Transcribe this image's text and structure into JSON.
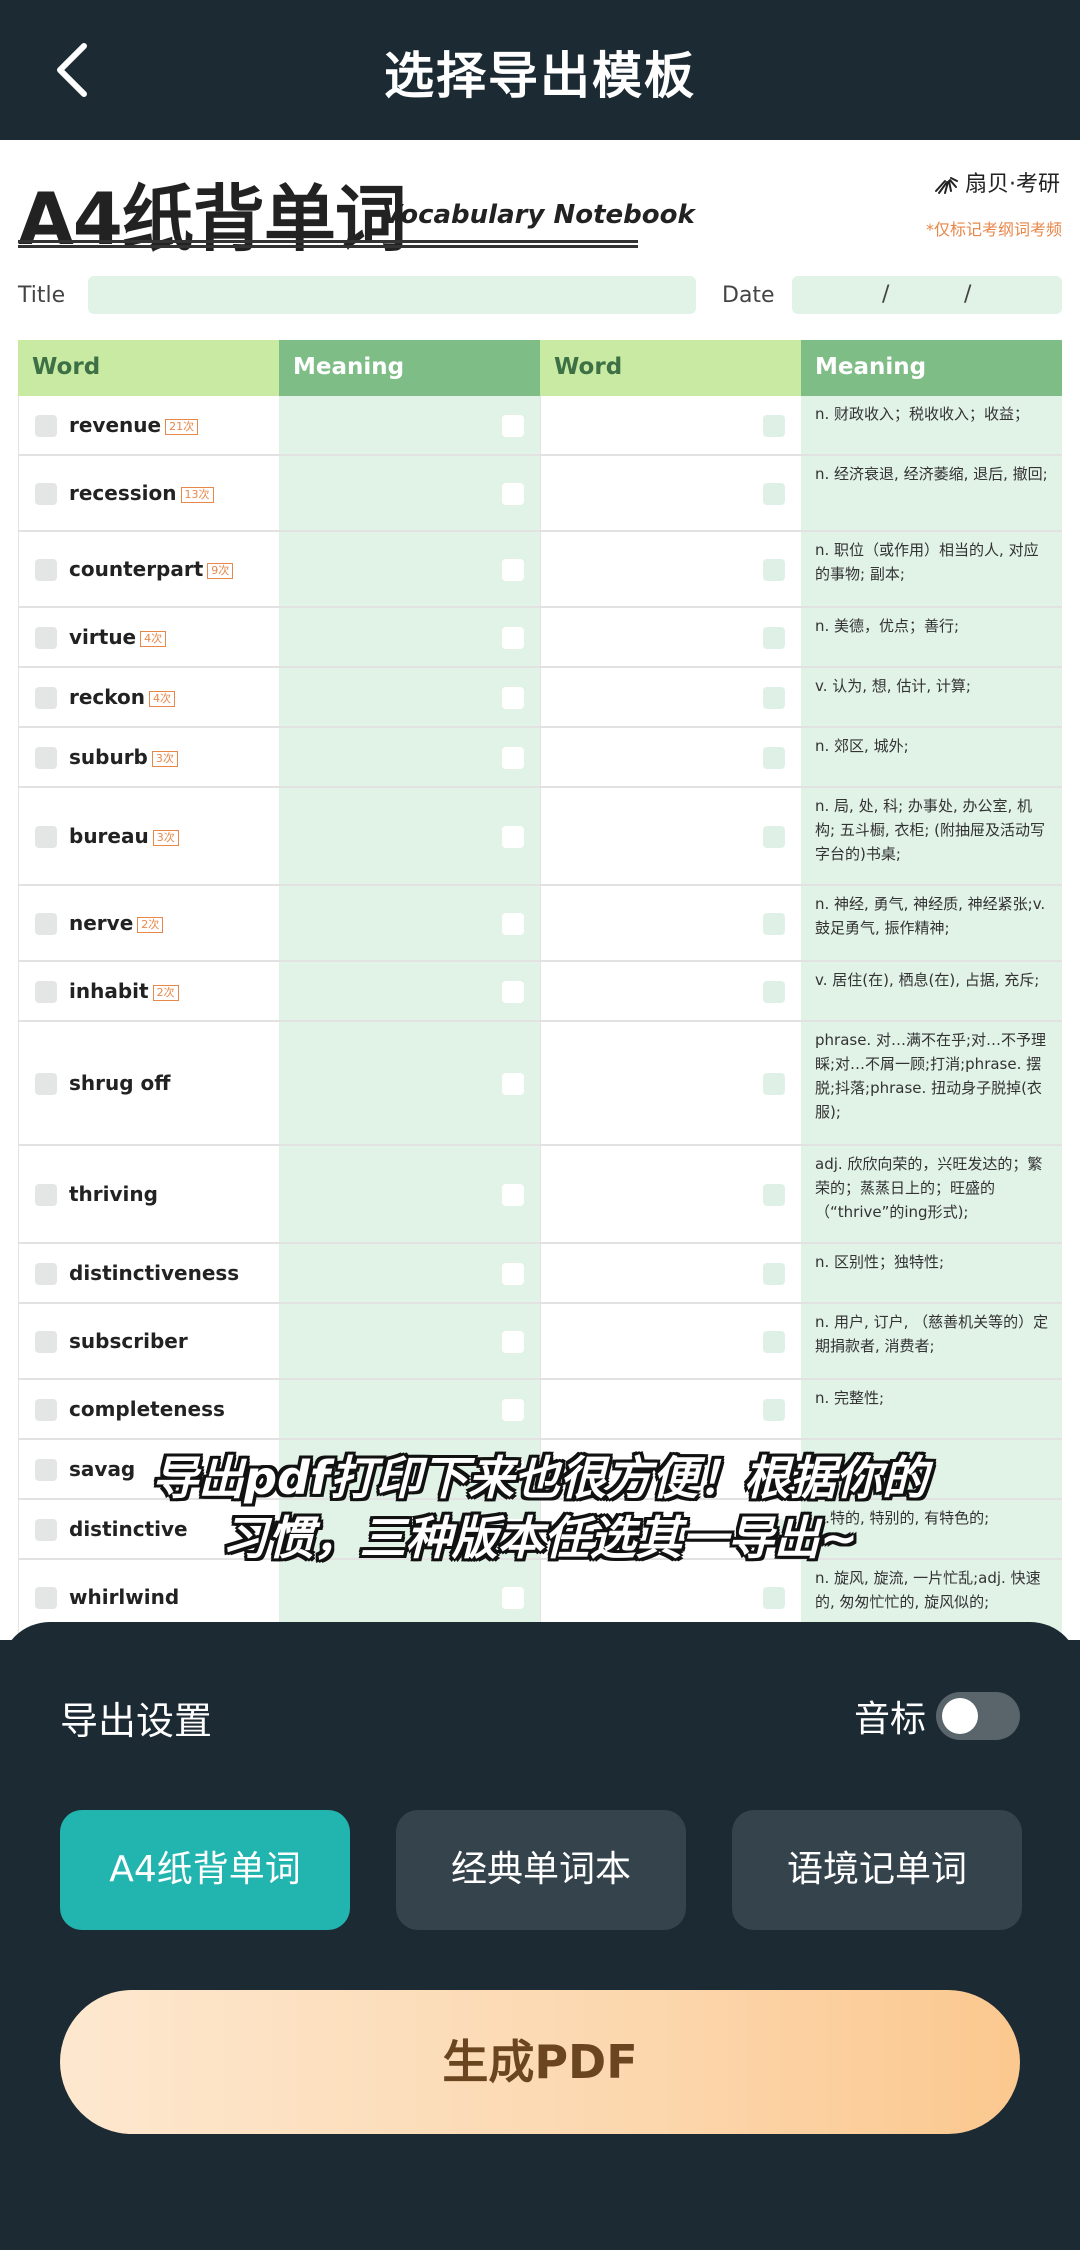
{
  "header": {
    "title": "选择导出模板"
  },
  "paper": {
    "title": "A4纸背单词",
    "subtitle": "Vocabulary Notebook",
    "brand": "扇贝·考研",
    "note": "*仅标记考纲词考频",
    "title_label": "Title",
    "date_label": "Date",
    "date_sep1": "/",
    "date_sep2": "/",
    "columns": [
      "Word",
      "Meaning",
      "Word",
      "Meaning"
    ],
    "rows": [
      {
        "word": "revenue",
        "freq": "21次",
        "meaning": "n. 财政收入；税收收入；收益；"
      },
      {
        "word": "recession",
        "freq": "13次",
        "meaning": "n. 经济衰退, 经济萎缩, 退后, 撤回;"
      },
      {
        "word": "counterpart",
        "freq": "9次",
        "meaning": "n. 职位（或作用）相当的人, 对应的事物; 副本;"
      },
      {
        "word": "virtue",
        "freq": "4次",
        "meaning": "n. 美德，优点；善行;"
      },
      {
        "word": "reckon",
        "freq": "4次",
        "meaning": "v. 认为, 想, 估计, 计算;"
      },
      {
        "word": "suburb",
        "freq": "3次",
        "meaning": "n. 郊区, 城外;"
      },
      {
        "word": "bureau",
        "freq": "3次",
        "meaning": "n. 局, 处, 科; 办事处, 办公室, 机构; 五斗橱, 衣柜; (附抽屉及活动写字台的)书桌;"
      },
      {
        "word": "nerve",
        "freq": "2次",
        "meaning": "n. 神经, 勇气, 神经质, 神经紧张;v. 鼓足勇气, 振作精神;"
      },
      {
        "word": "inhabit",
        "freq": "2次",
        "meaning": "v. 居住(在), 栖息(在), 占据, 充斥;"
      },
      {
        "word": "shrug off",
        "freq": "",
        "meaning": "phrase. 对…满不在乎;对…不予理睬;对…不屑一顾;打消;phrase. 摆脱;抖落;phrase. 扭动身子脱掉(衣服);"
      },
      {
        "word": "thriving",
        "freq": "",
        "meaning": "adj. 欣欣向荣的，兴旺发达的；繁荣的；蒸蒸日上的；旺盛的（“thrive”的ing形式);"
      },
      {
        "word": "distinctiveness",
        "freq": "",
        "meaning": "n. 区别性；独特性;"
      },
      {
        "word": "subscriber",
        "freq": "",
        "meaning": "n. 用户, 订户, （慈善机关等的）定期捐款者, 消费者;"
      },
      {
        "word": "completeness",
        "freq": "",
        "meaning": "n. 完整性;"
      },
      {
        "word": "savag",
        "freq": "",
        "meaning": ""
      },
      {
        "word": "distinctive",
        "freq": "",
        "meaning": "…特的, 特别的, 有特色的;"
      },
      {
        "word": "whirlwind",
        "freq": "",
        "meaning": "n. 旋风, 旋流, 一片忙乱;adj. 快速的, 匆匆忙忙的, 旋风似的;"
      }
    ]
  },
  "caption": {
    "line1": "导出pdf打印下来也很方便！根据你的",
    "line2": "习惯，三种版本任选其一导出~"
  },
  "sheet": {
    "title": "导出设置",
    "phonetic_label": "音标",
    "phonetic_on": false,
    "templates": [
      "A4纸背单词",
      "经典单词本",
      "语境记单词"
    ],
    "active_template": "A4纸背单词",
    "generate_label": "生成PDF"
  },
  "colors": {
    "bg": "#1c2a33",
    "accent": "#22b5b0",
    "header_word": "#c8eaa2",
    "header_meaning": "#7fbd87",
    "meaning_fill": "#e1f2e7",
    "freq": "#e8874a"
  }
}
